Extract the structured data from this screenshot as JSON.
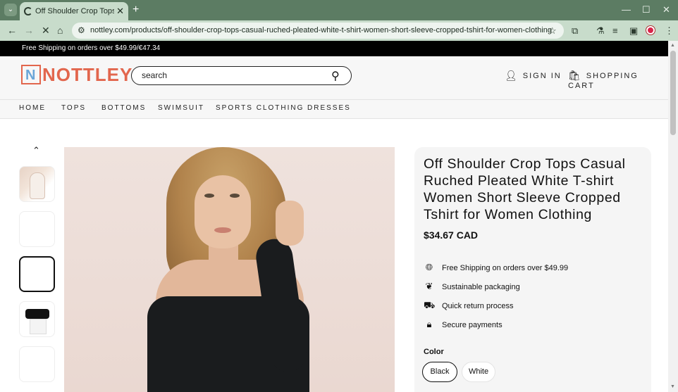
{
  "browser": {
    "tab_title": "Off Shoulder Crop Tops Casual",
    "tab_close": "✕",
    "new_tab": "+",
    "url": "nottley.com/products/off-shoulder-crop-tops-casual-ruched-pleated-white-t-shirt-women-short-sleeve-cropped-tshirt-for-women-clothing"
  },
  "promo_bar": "Free Shipping on orders over $49.99/€47.34",
  "header": {
    "logo_letter": "N",
    "logo_text": "NOTTLEY",
    "search_placeholder": "search",
    "sign_in": "SIGN IN",
    "cart": "SHOPPING CART"
  },
  "nav": [
    "HOME",
    "TOPS",
    "BOTTOMS",
    "SWIMSUIT",
    "SPORTS CLOTHING",
    "DRESSES"
  ],
  "product": {
    "title": "Off Shoulder Crop Tops Casual Ruched Pleated White T-shirt Women Short Sleeve Cropped Tshirt for Women Clothing",
    "price": "$34.67 CAD",
    "features": [
      {
        "icon": "globe-icon",
        "text": "Free Shipping on orders over $49.99"
      },
      {
        "icon": "leaf-icon",
        "text": "Sustainable packaging"
      },
      {
        "icon": "truck-icon",
        "text": "Quick return process"
      },
      {
        "icon": "lock-icon",
        "text": "Secure payments"
      }
    ],
    "color_label": "Color",
    "colors": [
      "Black",
      "White"
    ],
    "selected_color": "Black"
  }
}
